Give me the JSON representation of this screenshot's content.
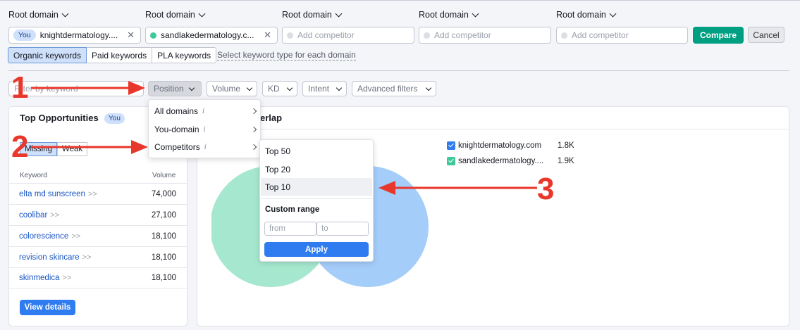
{
  "header": {
    "root_domain_labels": [
      "Root domain",
      "Root domain",
      "Root domain",
      "Root domain",
      "Root domain"
    ],
    "domains": [
      {
        "badge": "You",
        "value": "knightdermatology....",
        "placeholder": ""
      },
      {
        "badge": "",
        "value": "sandlakedermatology.c...",
        "placeholder": ""
      },
      {
        "badge": "",
        "value": "",
        "placeholder": "Add competitor"
      },
      {
        "badge": "",
        "value": "",
        "placeholder": "Add competitor"
      },
      {
        "badge": "",
        "value": "",
        "placeholder": "Add competitor"
      }
    ],
    "compare_label": "Compare",
    "cancel_label": "Cancel",
    "keyword_types": [
      "Organic keywords",
      "Paid keywords",
      "PLA keywords"
    ],
    "keyword_type_note": "Select keyword type for each domain"
  },
  "filters": {
    "search_placeholder": "Filter by keyword",
    "position_label": "Position",
    "volume_label": "Volume",
    "kd_label": "KD",
    "intent_label": "Intent",
    "advanced_label": "Advanced filters"
  },
  "position_menu": {
    "items": [
      "All domains",
      "You-domain",
      "Competitors"
    ],
    "info_glyph": "i"
  },
  "competitors_submenu": {
    "items": [
      "Top 50",
      "Top 20",
      "Top 10"
    ],
    "custom_range_label": "Custom range",
    "from_placeholder": "from",
    "to_placeholder": "to",
    "apply_label": "Apply"
  },
  "opportunities": {
    "title": "Top Opportunities",
    "badge": "You",
    "segments": [
      "Missing",
      "Weak"
    ],
    "col_keyword": "Keyword",
    "col_volume": "Volume",
    "rows": [
      {
        "keyword": "elta md sunscreen",
        "volume": "74,000"
      },
      {
        "keyword": "coolibar",
        "volume": "27,100"
      },
      {
        "keyword": "colorescience",
        "volume": "18,100"
      },
      {
        "keyword": "revision skincare",
        "volume": "18,100"
      },
      {
        "keyword": "skinmedica",
        "volume": "18,100"
      }
    ],
    "more_glyph": ">>",
    "view_details_label": "View details"
  },
  "overlap": {
    "title_visible": "erlap",
    "legend": [
      {
        "domain": "knightdermatology.com",
        "value": "1.8K",
        "color": "#2f7bf0"
      },
      {
        "domain": "sandlakedermatology....",
        "value": "1.9K",
        "color": "#3fc99a"
      }
    ]
  },
  "annotations": {
    "numbers": [
      "1",
      "2",
      "3"
    ],
    "color": "#e8372b"
  },
  "colors": {
    "accent_blue": "#2f7bf0",
    "compare_green": "#009f81",
    "venn_green": "#a6e8cf",
    "venn_blue": "#a4cdfa"
  }
}
